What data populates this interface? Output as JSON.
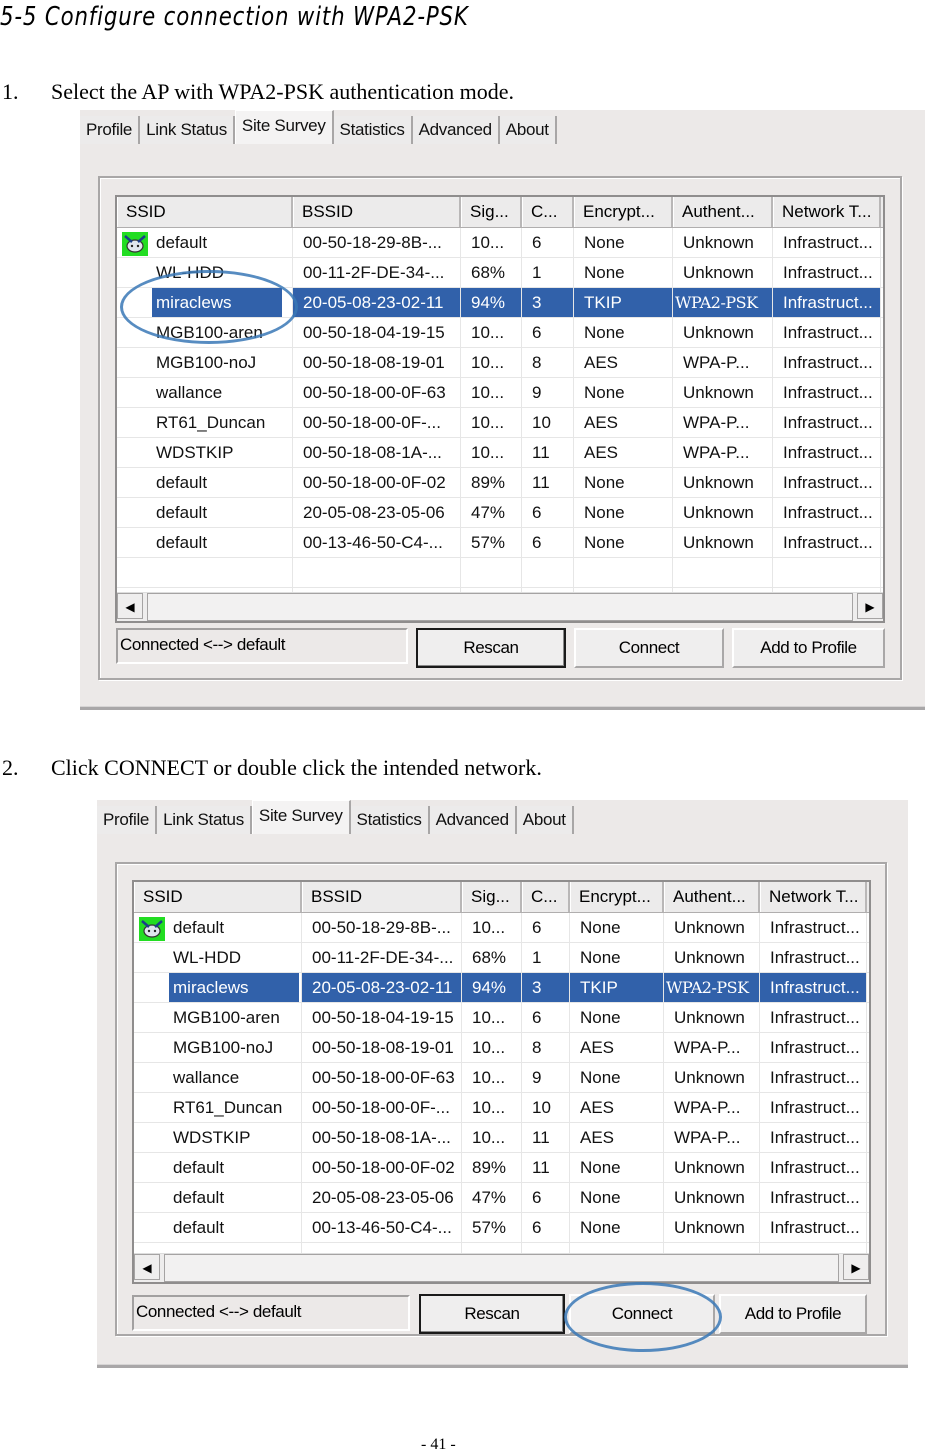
{
  "doc": {
    "heading": "5-5   Configure connection with WPA2-PSK",
    "steps": [
      {
        "num": "1.",
        "text": "Select the AP with WPA2-PSK authentication mode."
      },
      {
        "num": "2.",
        "text": "Click CONNECT or double click the intended network."
      }
    ],
    "page_number": "- 41 -"
  },
  "screenshot": {
    "tabs": [
      "Profile",
      "Link Status",
      "Site Survey",
      "Statistics",
      "Advanced",
      "About"
    ],
    "active_tab": "Site Survey",
    "columns": [
      "SSID",
      "BSSID",
      "Sig...",
      "C...",
      "Encrypt...",
      "Authent...",
      "Network T..."
    ],
    "rows": [
      {
        "ssid": "default",
        "bssid": "00-50-18-29-8B-...",
        "signal": "10...",
        "channel": "6",
        "encryption": "None",
        "auth": "Unknown",
        "network": "Infrastruct...",
        "connected_icon": "connected-icon"
      },
      {
        "ssid": "WL-HDD",
        "bssid": "00-11-2F-DE-34-...",
        "signal": "68%",
        "channel": "1",
        "encryption": "None",
        "auth": "Unknown",
        "network": "Infrastruct..."
      },
      {
        "ssid": "miraclews",
        "bssid": "20-05-08-23-02-11",
        "signal": "94%",
        "channel": "3",
        "encryption": "TKIP",
        "auth": "WPA2-PSK",
        "network": "Infrastruct...",
        "selected": true
      },
      {
        "ssid": "MGB100-aren",
        "bssid": "00-50-18-04-19-15",
        "signal": "10...",
        "channel": "6",
        "encryption": "None",
        "auth": "Unknown",
        "network": "Infrastruct..."
      },
      {
        "ssid": "MGB100-noJ",
        "bssid": "00-50-18-08-19-01",
        "signal": "10...",
        "channel": "8",
        "encryption": "AES",
        "auth": "WPA-P...",
        "network": "Infrastruct..."
      },
      {
        "ssid": "wallance",
        "bssid": "00-50-18-00-0F-63",
        "signal": "10...",
        "channel": "9",
        "encryption": "None",
        "auth": "Unknown",
        "network": "Infrastruct..."
      },
      {
        "ssid": "RT61_Duncan",
        "bssid": "00-50-18-00-0F-...",
        "signal": "10...",
        "channel": "10",
        "encryption": "AES",
        "auth": "WPA-P...",
        "network": "Infrastruct..."
      },
      {
        "ssid": "WDSTKIP",
        "bssid": "00-50-18-08-1A-...",
        "signal": "10...",
        "channel": "11",
        "encryption": "AES",
        "auth": "WPA-P...",
        "network": "Infrastruct..."
      },
      {
        "ssid": "default",
        "bssid": "00-50-18-00-0F-02",
        "signal": "89%",
        "channel": "11",
        "encryption": "None",
        "auth": "Unknown",
        "network": "Infrastruct..."
      },
      {
        "ssid": "default",
        "bssid": "20-05-08-23-05-06",
        "signal": "47%",
        "channel": "6",
        "encryption": "None",
        "auth": "Unknown",
        "network": "Infrastruct..."
      },
      {
        "ssid": "default",
        "bssid": "00-13-46-50-C4-...",
        "signal": "57%",
        "channel": "6",
        "encryption": "None",
        "auth": "Unknown",
        "network": "Infrastruct..."
      }
    ],
    "status_text": "Connected <--> default",
    "buttons": {
      "rescan": "Rescan",
      "connect": "Connect",
      "add_to_profile": "Add to Profile"
    },
    "scroll_left": "◀",
    "scroll_right": "▶",
    "colors": {
      "selection": "#3161aa",
      "callout": "#3a78b6",
      "window_bg": "#ece9e8"
    }
  },
  "annotations": {
    "shot1": "circle around selected row miraclews",
    "shot2": "circle around Connect button"
  }
}
